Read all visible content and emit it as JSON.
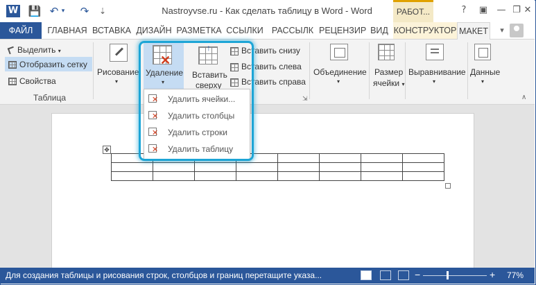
{
  "titlebar": {
    "app_icon": "W",
    "title": "Nastroyvse.ru - Как сделать таблицу в Word - Word",
    "context_label": "РАБОТ...",
    "help": "?",
    "minimize": "—",
    "restore": "❐",
    "close": "✕"
  },
  "qat": {
    "save_icon": "💾",
    "undo_icon": "↶",
    "redo_icon": "↷",
    "customize_icon": "⇣"
  },
  "tabs": [
    "ФАЙЛ",
    "ГЛАВНАЯ",
    "ВСТАВКА",
    "ДИЗАЙН",
    "РАЗМЕТКА",
    "ССЫЛКИ",
    "РАССЫЛК",
    "РЕЦЕНЗИР",
    "ВИД",
    "КОНСТРУКТОР",
    "МАКЕТ"
  ],
  "ribbon": {
    "table_group": {
      "select": "Выделить",
      "show_grid": "Отобразить сетку",
      "properties": "Свойства",
      "label": "Таблица"
    },
    "draw": "Рисование",
    "delete": "Удаление",
    "insert_above": [
      "Вставить",
      "сверху"
    ],
    "insert_below": "Вставить снизу",
    "insert_left": "Вставить слева",
    "insert_right": "Вставить справа",
    "merge": "Объединение",
    "cell_size": [
      "Размер",
      "ячейки"
    ],
    "alignment": "Выравнивание",
    "data": "Данные"
  },
  "delete_menu": [
    "Удалить ячейки...",
    "Удалить столбцы",
    "Удалить строки",
    "Удалить таблицу"
  ],
  "document": {
    "table": {
      "rows": 3,
      "cols": 8
    },
    "move_handle": "✥"
  },
  "statusbar": {
    "text": "Для создания таблицы и рисования строк, столбцов и границ перетащите указа...",
    "zoom_minus": "−",
    "zoom_plus": "+",
    "zoom_fraction": 0.77,
    "zoom_label": "77%"
  },
  "colors": {
    "word_blue": "#2b579a",
    "focus_cyan": "#1da5d6",
    "delete_red": "#d13c1c",
    "context_gold": "#e0a100"
  }
}
